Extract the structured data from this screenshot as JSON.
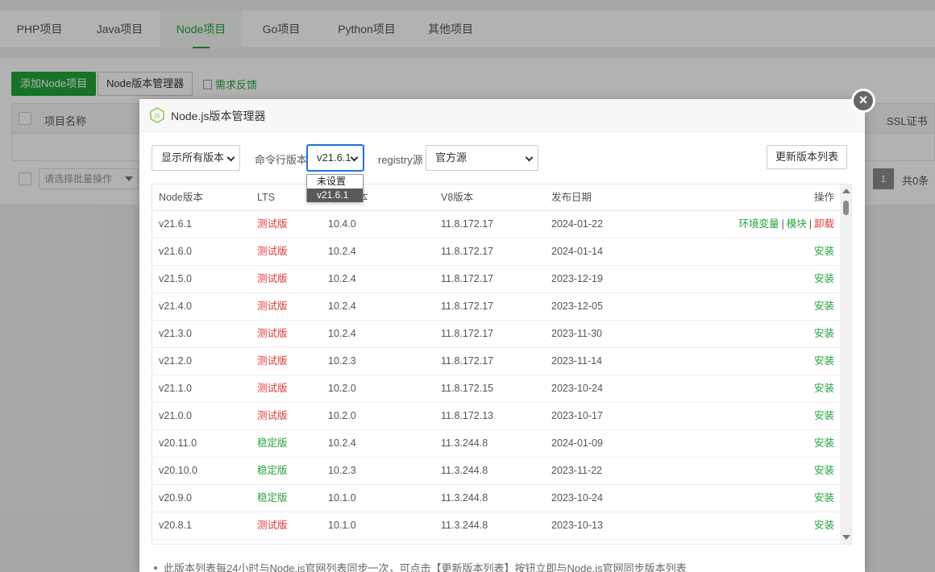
{
  "tabs": [
    {
      "label": "PHP项目"
    },
    {
      "label": "Java项目"
    },
    {
      "label": "Node项目"
    },
    {
      "label": "Go项目"
    },
    {
      "label": "Python项目"
    },
    {
      "label": "其他项目"
    }
  ],
  "toolbar": {
    "add_label": "添加Node项目",
    "manager_label": "Node版本管理器",
    "feedback_label": "需求反馈"
  },
  "bg_table": {
    "col_name": "项目名称",
    "col_ssl": "SSL证书",
    "batch_placeholder": "请选择批量操作",
    "page": "1",
    "total": "共0条"
  },
  "dialog": {
    "title": "Node.js版本管理器",
    "filter_value": "显示所有版本",
    "cli_label": "命令行版本",
    "cli_value": "v21.6.1",
    "registry_label": "registry源",
    "registry_value": "官方源",
    "refresh_label": "更新版本列表",
    "dropdown_options": [
      "未设置",
      "v21.6.1"
    ],
    "columns": {
      "ver": "Node版本",
      "lts": "LTS",
      "npm": "npm版本",
      "v8": "V8版本",
      "date": "发布日期",
      "op": "操作"
    },
    "op_labels": {
      "env": "环境变量",
      "module": "模块",
      "uninstall": "卸载",
      "install": "安装"
    },
    "rows": [
      {
        "ver": "v21.6.1",
        "lts": "测试版",
        "npm": "10.4.0",
        "v8": "11.8.172.17",
        "date": "2024-01-22"
      },
      {
        "ver": "v21.6.0",
        "lts": "测试版",
        "npm": "10.2.4",
        "v8": "11.8.172.17",
        "date": "2024-01-14"
      },
      {
        "ver": "v21.5.0",
        "lts": "测试版",
        "npm": "10.2.4",
        "v8": "11.8.172.17",
        "date": "2023-12-19"
      },
      {
        "ver": "v21.4.0",
        "lts": "测试版",
        "npm": "10.2.4",
        "v8": "11.8.172.17",
        "date": "2023-12-05"
      },
      {
        "ver": "v21.3.0",
        "lts": "测试版",
        "npm": "10.2.4",
        "v8": "11.8.172.17",
        "date": "2023-11-30"
      },
      {
        "ver": "v21.2.0",
        "lts": "测试版",
        "npm": "10.2.3",
        "v8": "11.8.172.17",
        "date": "2023-11-14"
      },
      {
        "ver": "v21.1.0",
        "lts": "测试版",
        "npm": "10.2.0",
        "v8": "11.8.172.15",
        "date": "2023-10-24"
      },
      {
        "ver": "v21.0.0",
        "lts": "测试版",
        "npm": "10.2.0",
        "v8": "11.8.172.13",
        "date": "2023-10-17"
      },
      {
        "ver": "v20.11.0",
        "lts": "稳定版",
        "npm": "10.2.4",
        "v8": "11.3.244.8",
        "date": "2024-01-09"
      },
      {
        "ver": "v20.10.0",
        "lts": "稳定版",
        "npm": "10.2.3",
        "v8": "11.3.244.8",
        "date": "2023-11-22"
      },
      {
        "ver": "v20.9.0",
        "lts": "稳定版",
        "npm": "10.1.0",
        "v8": "11.3.244.8",
        "date": "2023-10-24"
      },
      {
        "ver": "v20.8.1",
        "lts": "测试版",
        "npm": "10.1.0",
        "v8": "11.3.244.8",
        "date": "2023-10-13"
      }
    ],
    "note": "此版本列表每24小时与Node.js官网列表同步一次，可点击【更新版本列表】按钮立即与Node.js官网同步版本列表"
  }
}
